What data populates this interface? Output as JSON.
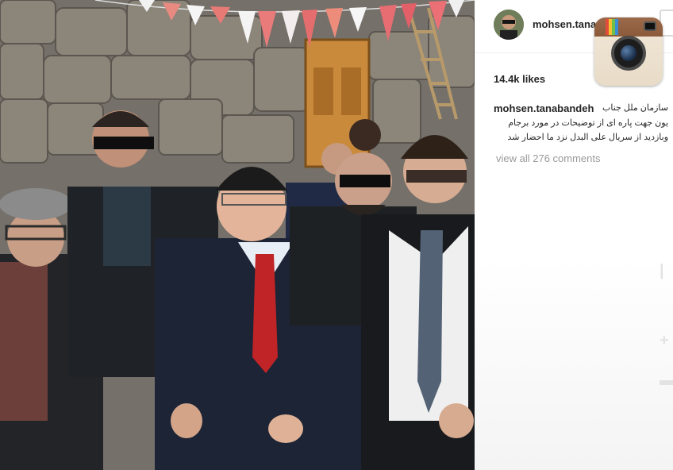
{
  "post": {
    "username": "mohsen.tanabandeh",
    "header_username": "mohsen.tana",
    "likes": "14.4k likes",
    "caption_user": "mohsen.tanabandeh",
    "caption_lines": [
      "سازمان ملل جناب",
      "یون جهت پاره ای از توضیحات در مورد برجام",
      "وبازدید از سریال علی البدل نزد ما احضار شد"
    ],
    "view_comments": "view all 276 comments"
  },
  "icons": {
    "avatar": "profile-avatar",
    "logo": "instagram-camera-logo"
  },
  "colors": {
    "username": "#262626",
    "muted": "#999999",
    "photo_background": "#6f6a60"
  }
}
